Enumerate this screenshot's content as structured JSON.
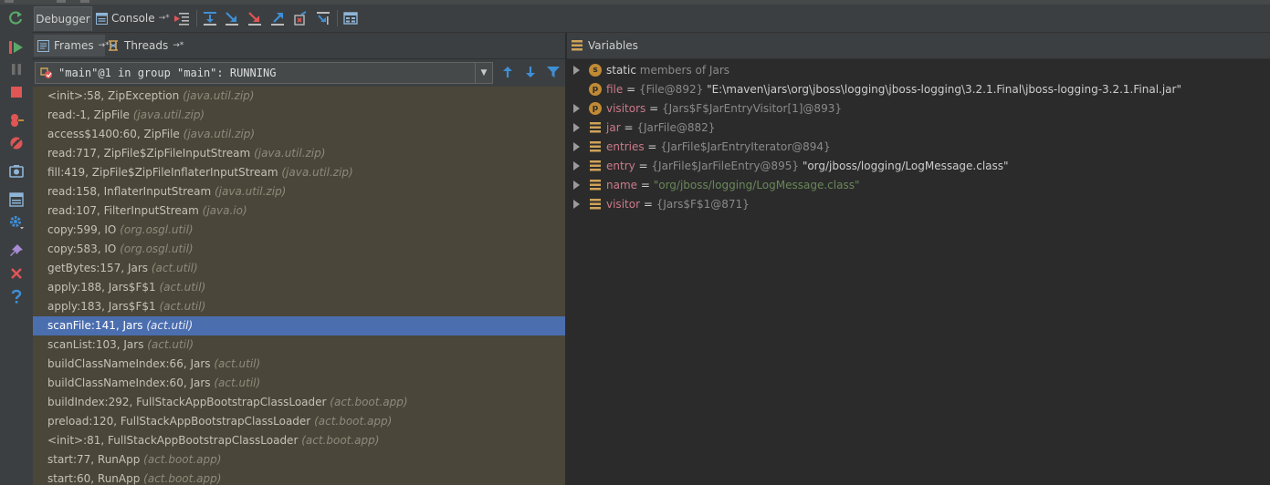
{
  "toolbar": {
    "debugger_tab": "Debugger",
    "console_tab": "Console",
    "console_pin": "→*"
  },
  "frames_panel": {
    "frames_tab": "Frames",
    "frames_pin": "→*",
    "threads_tab": "Threads",
    "threads_pin": "→*",
    "thread_selector": "\"main\"@1 in group \"main\": RUNNING",
    "frames": [
      {
        "method": "<init>:58, ZipException",
        "package": "(java.util.zip)"
      },
      {
        "method": "read:-1, ZipFile",
        "package": "(java.util.zip)"
      },
      {
        "method": "access$1400:60, ZipFile",
        "package": "(java.util.zip)"
      },
      {
        "method": "read:717, ZipFile$ZipFileInputStream",
        "package": "(java.util.zip)"
      },
      {
        "method": "fill:419, ZipFile$ZipFileInflaterInputStream",
        "package": "(java.util.zip)"
      },
      {
        "method": "read:158, InflaterInputStream",
        "package": "(java.util.zip)"
      },
      {
        "method": "read:107, FilterInputStream",
        "package": "(java.io)"
      },
      {
        "method": "copy:599, IO",
        "package": "(org.osgl.util)"
      },
      {
        "method": "copy:583, IO",
        "package": "(org.osgl.util)"
      },
      {
        "method": "getBytes:157, Jars",
        "package": "(act.util)"
      },
      {
        "method": "apply:188, Jars$F$1",
        "package": "(act.util)"
      },
      {
        "method": "apply:183, Jars$F$1",
        "package": "(act.util)"
      },
      {
        "method": "scanFile:141, Jars",
        "package": "(act.util)",
        "selected": true
      },
      {
        "method": "scanList:103, Jars",
        "package": "(act.util)"
      },
      {
        "method": "buildClassNameIndex:66, Jars",
        "package": "(act.util)"
      },
      {
        "method": "buildClassNameIndex:60, Jars",
        "package": "(act.util)"
      },
      {
        "method": "buildIndex:292, FullStackAppBootstrapClassLoader",
        "package": "(act.boot.app)"
      },
      {
        "method": "preload:120, FullStackAppBootstrapClassLoader",
        "package": "(act.boot.app)"
      },
      {
        "method": "<init>:81, FullStackAppBootstrapClassLoader",
        "package": "(act.boot.app)"
      },
      {
        "method": "start:77, RunApp",
        "package": "(act.boot.app)"
      },
      {
        "method": "start:60, RunApp",
        "package": "(act.boot.app)"
      }
    ]
  },
  "variables_panel": {
    "title": "Variables",
    "variables": [
      {
        "kind": "static",
        "icon": "static-badge-icon",
        "badge": "s",
        "name": "static",
        "rest": "members of Jars",
        "expandable": true
      },
      {
        "kind": "field",
        "icon": "field-badge-icon",
        "badge": "p",
        "name": "file",
        "eq": " = ",
        "ref": "{File@892}",
        "value": "\"E:\\maven\\jars\\org\\jboss\\logging\\jboss-logging\\3.2.1.Final\\jboss-logging-3.2.1.Final.jar\"",
        "value_style": "plain",
        "expandable": false
      },
      {
        "kind": "field",
        "icon": "field-badge-icon",
        "badge": "p",
        "name": "visitors",
        "eq": " = ",
        "ref": "{Jars$F$JarEntryVisitor[1]@893}",
        "value": "",
        "expandable": true
      },
      {
        "kind": "local",
        "icon": "local-variable-icon",
        "name": "jar",
        "eq": " = ",
        "ref": "{JarFile@882}",
        "value": "",
        "expandable": true
      },
      {
        "kind": "local",
        "icon": "local-variable-icon",
        "name": "entries",
        "eq": " = ",
        "ref": "{JarFile$JarEntryIterator@894}",
        "value": "",
        "expandable": true
      },
      {
        "kind": "local",
        "icon": "local-variable-icon",
        "name": "entry",
        "eq": " = ",
        "ref": "{JarFile$JarFileEntry@895}",
        "value": "\"org/jboss/logging/LogMessage.class\"",
        "value_style": "plain",
        "expandable": true
      },
      {
        "kind": "local",
        "icon": "local-variable-icon",
        "name": "name",
        "eq": " = ",
        "ref": "",
        "value": "\"org/jboss/logging/LogMessage.class\"",
        "value_style": "string",
        "expandable": true
      },
      {
        "kind": "local",
        "icon": "local-variable-icon",
        "name": "visitor",
        "eq": " = ",
        "ref": "{Jars$F$1@871}",
        "value": "",
        "expandable": true
      }
    ]
  },
  "colors": {
    "selection": "#4b6eaf",
    "frames_background": "#4a4639",
    "variable_name": "#cc7a8b",
    "string_value": "#6a8759",
    "badge": "#c18a33"
  }
}
